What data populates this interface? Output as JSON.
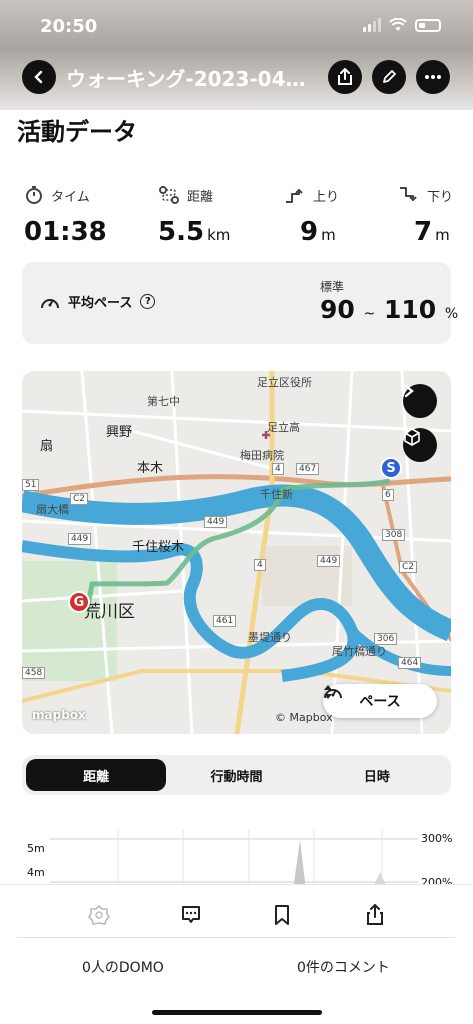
{
  "status_bar": {
    "time": "20:50"
  },
  "header": {
    "title": "ウォーキング-2023-04…",
    "back_icon": "chevron-left-icon",
    "share_icon": "share-icon",
    "edit_icon": "pencil-icon",
    "more_icon": "more-dots-icon"
  },
  "section_title": "活動データ",
  "stats": [
    {
      "label": "タイム",
      "value": "01:38",
      "unit": "",
      "icon": "stopwatch-icon"
    },
    {
      "label": "距離",
      "value": "5.5",
      "unit": "km",
      "icon": "route-icon"
    },
    {
      "label": "上り",
      "value": "9",
      "unit": "m",
      "icon": "ascent-icon"
    },
    {
      "label": "下り",
      "value": "7",
      "unit": "m",
      "icon": "descent-icon"
    }
  ],
  "pace": {
    "label": "平均ペース",
    "help": "?",
    "standard_label": "標準",
    "range_low": "90",
    "range_sep": "~",
    "range_high": "110",
    "range_unit": "%"
  },
  "map": {
    "labels": [
      "第七中",
      "足立区役所",
      "足立高",
      "興野",
      "梅田病院",
      "本木",
      "千住新",
      "扇",
      "扇大橋",
      "千住桜木",
      "荒川区",
      "尾竹橋通り",
      "墨堤通り"
    ],
    "roads": [
      "51",
      "C2",
      "449",
      "4",
      "467",
      "6",
      "308",
      "C2",
      "449",
      "461",
      "4",
      "449",
      "458",
      "306",
      "464"
    ],
    "start_pin": "S",
    "goal_pin": "G",
    "pace_toggle": "ペース",
    "attribution": "© Mapbox",
    "logo": "mapbox"
  },
  "tabs": [
    {
      "label": "距離",
      "active": true
    },
    {
      "label": "行動時間",
      "active": false
    },
    {
      "label": "日時",
      "active": false
    }
  ],
  "chart": {
    "y_ticks_left": [
      "5m",
      "4m"
    ],
    "y_ticks_right": [
      "300%",
      "200%"
    ]
  },
  "footer": {
    "domo_count": "0人のDOMO",
    "comment_count": "0件のコメント"
  },
  "colors": {
    "accent_red": "#d0312d",
    "start_blue": "#2a63d8",
    "river": "#47a8d8",
    "route_green": "#6dbb8f"
  }
}
